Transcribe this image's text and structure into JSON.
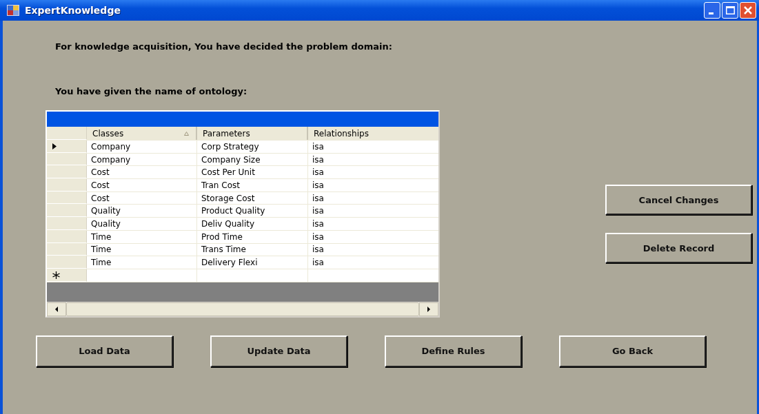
{
  "window": {
    "title": "ExpertKnowledge"
  },
  "prompts": [
    "For knowledge acquisition, You have decided the problem domain:",
    "You have given the name of ontology:"
  ],
  "table": {
    "columns": [
      {
        "label": "Classes",
        "sorted": true
      },
      {
        "label": "Parameters",
        "sorted": false
      },
      {
        "label": "Relationships",
        "sorted": false
      }
    ],
    "rows": [
      {
        "selected": true,
        "cells": [
          "Company",
          "Corp Strategy",
          "isa"
        ]
      },
      {
        "selected": false,
        "cells": [
          "Company",
          "Company Size",
          "isa"
        ]
      },
      {
        "selected": false,
        "cells": [
          "Cost",
          "Cost Per Unit",
          "isa"
        ]
      },
      {
        "selected": false,
        "cells": [
          "Cost",
          "Tran Cost",
          "isa"
        ]
      },
      {
        "selected": false,
        "cells": [
          "Cost",
          "Storage Cost",
          "isa"
        ]
      },
      {
        "selected": false,
        "cells": [
          "Quality",
          "Product Quality",
          "isa"
        ]
      },
      {
        "selected": false,
        "cells": [
          "Quality",
          "Deliv Quality",
          "isa"
        ]
      },
      {
        "selected": false,
        "cells": [
          "Time",
          "Prod Time",
          "isa"
        ]
      },
      {
        "selected": false,
        "cells": [
          "Time",
          "Trans Time",
          "isa"
        ]
      },
      {
        "selected": false,
        "cells": [
          "Time",
          "Delivery Flexi",
          "isa"
        ]
      }
    ],
    "new_row": true
  },
  "side_buttons": [
    {
      "label": "Cancel Changes"
    },
    {
      "label": "Delete Record"
    }
  ],
  "bottom_buttons": [
    {
      "label": "Load Data"
    },
    {
      "label": "Update Data"
    },
    {
      "label": "Define Rules"
    },
    {
      "label": "Go Back"
    }
  ]
}
